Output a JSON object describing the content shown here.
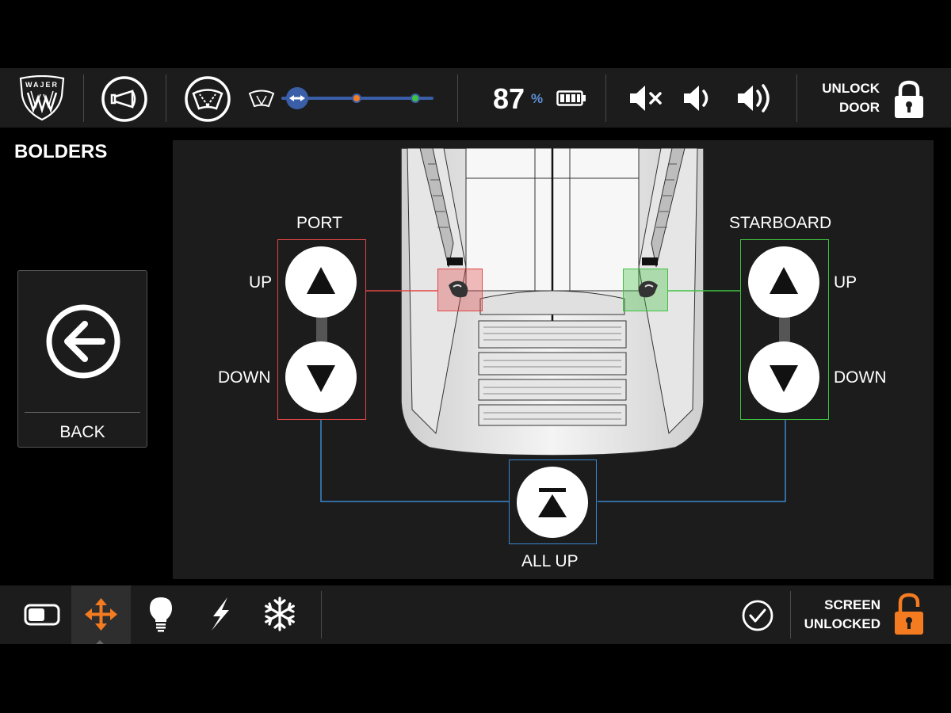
{
  "header": {
    "logo_text": "WAJER",
    "battery_percent": "87",
    "battery_unit": "%",
    "door_lock_label_line1": "UNLOCK",
    "door_lock_label_line2": "DOOR",
    "wiper_speed_level": 0
  },
  "sidebar": {
    "section_title": "BOLDERS",
    "back_label": "BACK"
  },
  "bolders": {
    "port_title": "PORT",
    "starboard_title": "STARBOARD",
    "port_up_label": "UP",
    "port_down_label": "DOWN",
    "starboard_up_label": "UP",
    "starboard_down_label": "DOWN",
    "all_up_label": "ALL UP"
  },
  "footer": {
    "screen_lock_line1": "SCREEN",
    "screen_lock_line2": "UNLOCKED",
    "active_mode": "move-arrows-icon"
  },
  "colors": {
    "port_accent": "#e04646",
    "starboard_accent": "#3fc23f",
    "all_up_accent": "#3a86cf",
    "battery_unit": "#5b8fd6",
    "active_mode": "#f47b20",
    "screen_lock": "#f47b20",
    "wiper_slider": "#3a5fa8"
  }
}
